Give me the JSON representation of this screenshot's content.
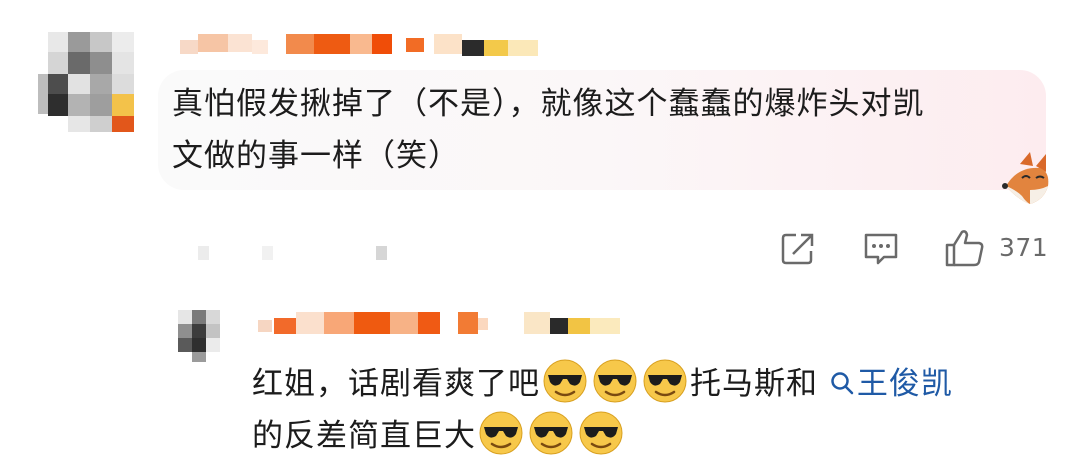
{
  "comment": {
    "text_line1": "真怕假发揪掉了（不是），就像这个蠢蠢的爆炸头对凯",
    "text_line2": "文做的事一样（笑）",
    "like_count": "371",
    "icons": [
      "share-icon",
      "comment-icon",
      "like-icon"
    ]
  },
  "reply": {
    "text_part1": "红姐，话剧看爽了吧",
    "text_part2": "托马斯和",
    "mention": "王俊凯",
    "text_line2": "的反差简直巨大",
    "emoji_name": "cool-sunglasses-emoji"
  },
  "colors": {
    "mention": "#1f5aa6",
    "action_gray": "#6a6a6a",
    "bubble_tint": "#fdecef"
  }
}
